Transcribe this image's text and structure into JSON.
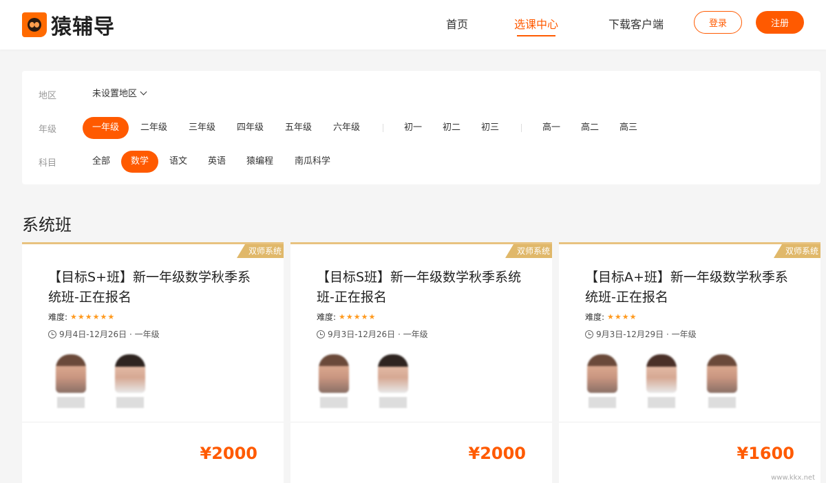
{
  "header": {
    "logo_text": "猿辅导",
    "nav": [
      {
        "label": "首页",
        "active": false
      },
      {
        "label": "选课中心",
        "active": true
      },
      {
        "label": "下载客户端",
        "active": false
      }
    ],
    "login_label": "登录",
    "register_label": "注册"
  },
  "filters": {
    "region": {
      "label": "地区",
      "value": "未设置地区"
    },
    "grade": {
      "label": "年级",
      "options": [
        "一年级",
        "二年级",
        "三年级",
        "四年级",
        "五年级",
        "六年级",
        "初一",
        "初二",
        "初三",
        "高一",
        "高二",
        "高三"
      ],
      "selected": "一年级"
    },
    "subject": {
      "label": "科目",
      "options": [
        "全部",
        "数学",
        "语文",
        "英语",
        "猿编程",
        "南瓜科学"
      ],
      "selected": "数学"
    }
  },
  "section_title": "系统班",
  "courses": [
    {
      "tag": "双师系统",
      "title": "【目标S+班】新一年级数学秋季系统班-正在报名",
      "difficulty_label": "难度:",
      "difficulty_stars": 6,
      "date": "9月4日-12月26日 · 一年级",
      "teachers": 2,
      "price": "¥2000"
    },
    {
      "tag": "双师系统",
      "title": "【目标S班】新一年级数学秋季系统班-正在报名",
      "difficulty_label": "难度:",
      "difficulty_stars": 5,
      "date": "9月3日-12月26日 · 一年级",
      "teachers": 2,
      "price": "¥2000"
    },
    {
      "tag": "双师系统",
      "title": "【目标A+班】新一年级数学秋季系统班-正在报名",
      "difficulty_label": "难度:",
      "difficulty_stars": 4,
      "date": "9月3日-12月29日 · 一年级",
      "teachers": 3,
      "price": "¥1600"
    }
  ],
  "watermark": "www.kkx.net",
  "colors": {
    "accent": "#ff5a00",
    "tag": "#e0b86a",
    "star": "#ff9a1f"
  }
}
